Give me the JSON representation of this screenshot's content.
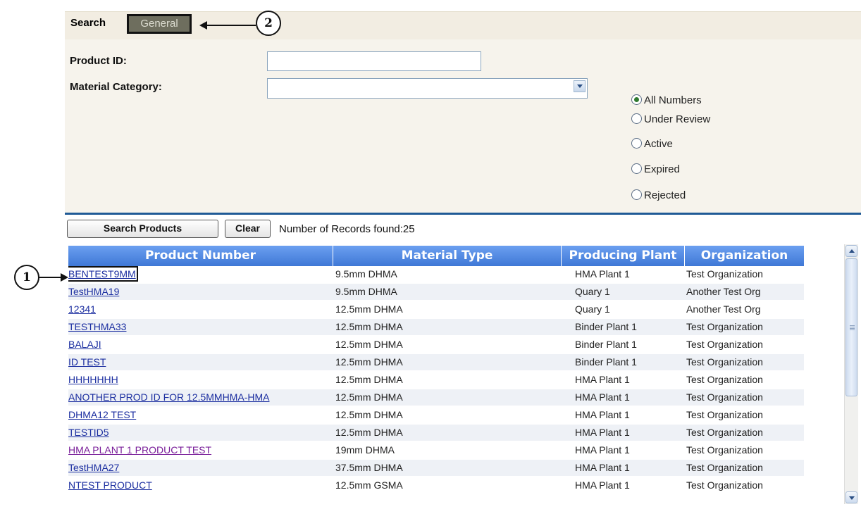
{
  "tabs": {
    "search_label": "Search",
    "general_label": "General"
  },
  "form": {
    "product_id_label": "Product ID:",
    "product_id_value": "",
    "material_category_label": "Material Category:",
    "material_category_value": ""
  },
  "status_filter": {
    "selected": "All Numbers",
    "options": [
      "All Numbers",
      "Under Review",
      "Active",
      "Expired",
      "Rejected"
    ]
  },
  "actions": {
    "search_label": "Search Products",
    "clear_label": "Clear",
    "records_text": "Number of Records found:25"
  },
  "table": {
    "headers": [
      "Product Number",
      "Material Type",
      "Producing Plant",
      "Organization"
    ],
    "rows": [
      [
        "BENTEST9MM",
        "9.5mm DHMA",
        "HMA Plant 1",
        "Test Organization"
      ],
      [
        "TestHMA19",
        "9.5mm DHMA",
        "Quary 1",
        "Another Test Org"
      ],
      [
        "12341",
        "12.5mm DHMA",
        "Quary 1",
        "Another Test Org"
      ],
      [
        "TESTHMA33",
        "12.5mm DHMA",
        "Binder Plant 1",
        "Test Organization"
      ],
      [
        "BALAJI",
        "12.5mm DHMA",
        "Binder Plant 1",
        "Test Organization"
      ],
      [
        "ID TEST",
        "12.5mm DHMA",
        "Binder Plant 1",
        "Test Organization"
      ],
      [
        "HHHHHHH",
        "12.5mm DHMA",
        "HMA Plant 1",
        "Test Organization"
      ],
      [
        "ANOTHER PROD ID FOR 12.5MMHMA-HMA",
        "12.5mm DHMA",
        "HMA Plant 1",
        "Test Organization"
      ],
      [
        "DHMA12 TEST",
        "12.5mm DHMA",
        "HMA Plant 1",
        "Test Organization"
      ],
      [
        "TESTID5",
        "12.5mm DHMA",
        "HMA Plant 1",
        "Test Organization"
      ],
      [
        "HMA PLANT 1 PRODUCT TEST",
        "19mm DHMA",
        "HMA Plant 1",
        "Test Organization"
      ],
      [
        "TestHMA27",
        "37.5mm DHMA",
        "HMA Plant 1",
        "Test Organization"
      ],
      [
        "NTEST PRODUCT",
        "12.5mm GSMA",
        "HMA Plant 1",
        "Test Organization"
      ]
    ],
    "visited_row": 10,
    "highlighted_row": 0
  },
  "callouts": {
    "one": "1",
    "two": "2"
  },
  "colors": {
    "header": "#4a85e0",
    "divider": "#1f5a96",
    "link": "#1b2ea0",
    "visited_link": "#7a1f9a",
    "general_tab": "#6e6e5e"
  }
}
